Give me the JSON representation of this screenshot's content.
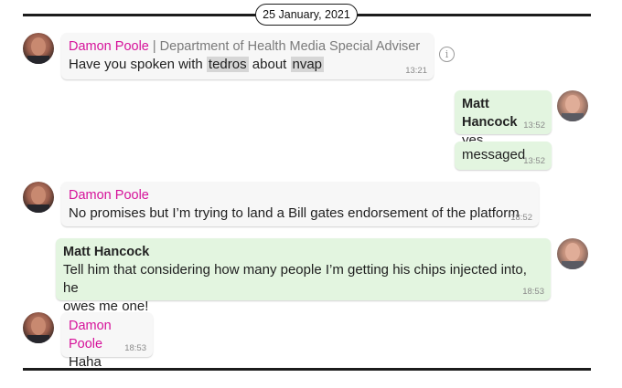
{
  "date_label": "25 January, 2021",
  "colors": {
    "sender_pink": "#d6129a",
    "incoming_bubble": "#f7f7f7",
    "outgoing_bubble": "#e3f5e0",
    "rule": "#1c1c1c"
  },
  "messages": [
    {
      "sender": "Damon Poole",
      "role": "| Department of Health Media Special Adviser",
      "text_parts": [
        "Have you spoken with ",
        "tedros",
        " about ",
        "nvap"
      ],
      "time": "13:21"
    },
    {
      "sender": "Matt Hancock",
      "text": "yes",
      "time": "13:52"
    },
    {
      "text": "messaged",
      "time": "13:52"
    },
    {
      "sender": "Damon Poole",
      "text": "No promises but I’m trying to land a Bill gates endorsement of the platform",
      "time": "18:52"
    },
    {
      "sender": "Matt Hancock",
      "text_line1": "Tell him that considering how many people I’m getting his chips injected into, he",
      "text_line2": "owes me one!",
      "time": "18:53"
    },
    {
      "sender": "Damon Poole",
      "text": "Haha",
      "time": "18:53"
    }
  ],
  "icons": {
    "info": "info-icon",
    "avatar_damon": "avatar",
    "avatar_matt": "avatar"
  }
}
